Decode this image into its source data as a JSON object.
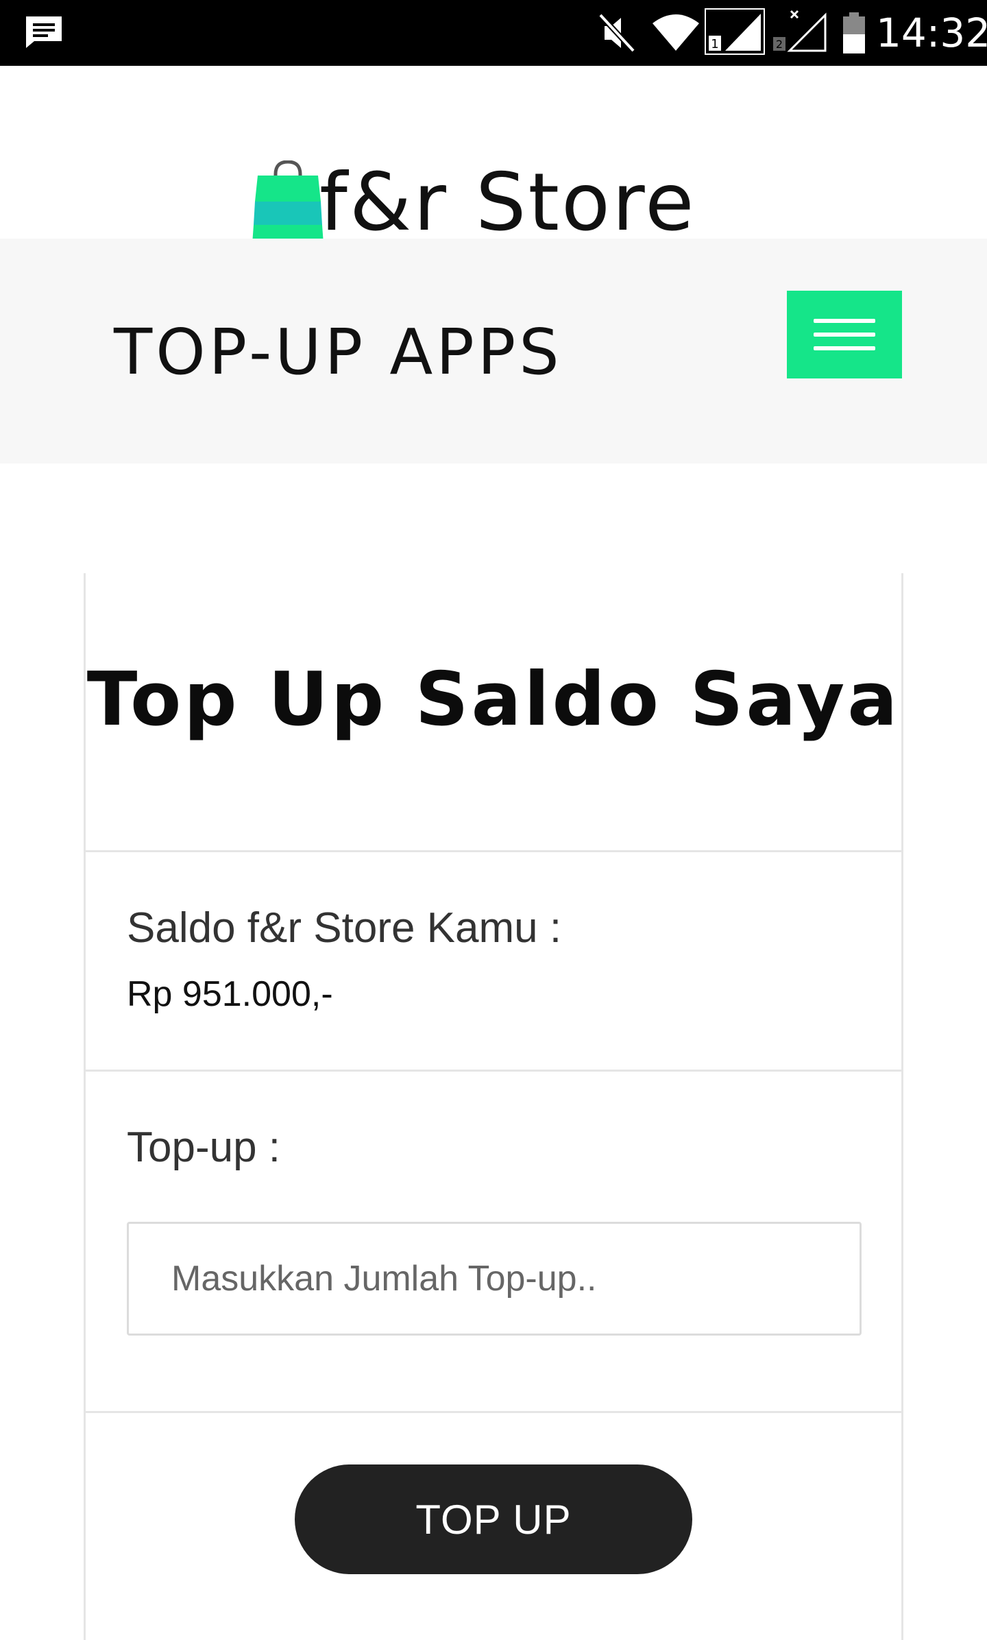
{
  "status_bar": {
    "time": "14:32",
    "icons": [
      "message-icon",
      "mute-icon",
      "wifi-icon",
      "signal-sim1-icon",
      "signal-sim2-icon",
      "battery-icon"
    ]
  },
  "brand": {
    "name": "f&r Store",
    "logo_icon": "shopping-bag-icon",
    "logo_colors": {
      "bag_top": "#15e589",
      "bag_band": "#19c6b8"
    }
  },
  "navbar": {
    "title": "TOP-UP APPS",
    "menu_icon": "hamburger-icon",
    "menu_color": "#15e589"
  },
  "card": {
    "title": "Top Up Saldo Saya",
    "balance_label": "Saldo f&r Store Kamu :",
    "balance_value": "Rp 951.000,-",
    "topup_label": "Top-up :",
    "topup_placeholder": "Masukkan Jumlah Top-up..",
    "topup_value": "",
    "submit_label": "TOP UP"
  }
}
